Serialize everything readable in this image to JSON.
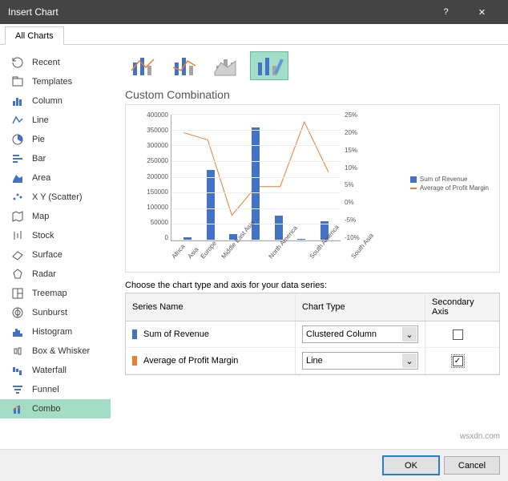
{
  "titlebar": {
    "title": "Insert Chart"
  },
  "tabs": {
    "all_charts": "All Charts"
  },
  "sidebar": {
    "items": [
      {
        "label": "Recent",
        "icon": "recent"
      },
      {
        "label": "Templates",
        "icon": "templates"
      },
      {
        "label": "Column",
        "icon": "column"
      },
      {
        "label": "Line",
        "icon": "line"
      },
      {
        "label": "Pie",
        "icon": "pie"
      },
      {
        "label": "Bar",
        "icon": "bar"
      },
      {
        "label": "Area",
        "icon": "area"
      },
      {
        "label": "X Y (Scatter)",
        "icon": "scatter"
      },
      {
        "label": "Map",
        "icon": "map"
      },
      {
        "label": "Stock",
        "icon": "stock"
      },
      {
        "label": "Surface",
        "icon": "surface"
      },
      {
        "label": "Radar",
        "icon": "radar"
      },
      {
        "label": "Treemap",
        "icon": "treemap"
      },
      {
        "label": "Sunburst",
        "icon": "sunburst"
      },
      {
        "label": "Histogram",
        "icon": "histogram"
      },
      {
        "label": "Box & Whisker",
        "icon": "box"
      },
      {
        "label": "Waterfall",
        "icon": "waterfall"
      },
      {
        "label": "Funnel",
        "icon": "funnel"
      },
      {
        "label": "Combo",
        "icon": "combo"
      }
    ]
  },
  "main_title": "Custom Combination",
  "choose_label": "Choose the chart type and axis for your data series:",
  "series_table": {
    "headers": {
      "name": "Series Name",
      "type": "Chart Type",
      "axis": "Secondary Axis"
    },
    "rows": [
      {
        "name": "Sum of Revenue",
        "type": "Clustered Column",
        "secondary": false,
        "color": "#4472c4"
      },
      {
        "name": "Average of Profit Margin",
        "type": "Line",
        "secondary": true,
        "color": "#ed7d31"
      }
    ]
  },
  "legend": {
    "s1": "Sum of Revenue",
    "s2": "Average of Profit Margin"
  },
  "footer": {
    "ok": "OK",
    "cancel": "Cancel"
  },
  "watermark": "wsxdn.com",
  "chart_data": {
    "type": "combo",
    "categories": [
      "Africa",
      "Asia",
      "Europe",
      "Middle East Asia",
      "North America",
      "South America",
      "South Asia"
    ],
    "series": [
      {
        "name": "Sum of Revenue",
        "type": "bar",
        "axis": "left",
        "values": [
          10000,
          225000,
          20000,
          360000,
          80000,
          5000,
          60000
        ]
      },
      {
        "name": "Average of Profit Margin",
        "type": "line",
        "axis": "right",
        "values": [
          20,
          18,
          -3,
          5,
          5,
          23,
          9
        ]
      }
    ],
    "left_axis": {
      "min": 0,
      "max": 400000,
      "ticks": [
        0,
        50000,
        100000,
        150000,
        200000,
        250000,
        300000,
        350000,
        400000
      ]
    },
    "right_axis": {
      "min": -10,
      "max": 25,
      "ticks": [
        -10,
        -5,
        0,
        5,
        10,
        15,
        20,
        25
      ]
    }
  }
}
